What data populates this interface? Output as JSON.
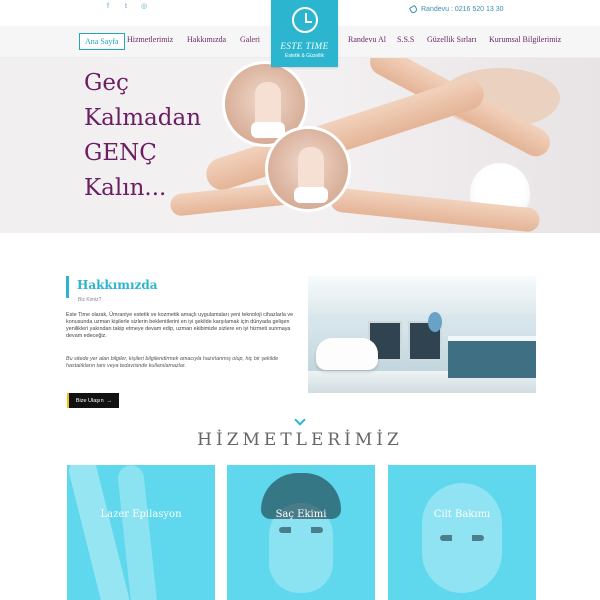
{
  "topbar": {
    "social": [
      {
        "icon": "facebook-icon",
        "glyph": "f"
      },
      {
        "icon": "twitter-icon",
        "glyph": "t"
      },
      {
        "icon": "instagram-icon",
        "glyph": "◎"
      }
    ],
    "phone": "Randevu : 0216 520 13 30"
  },
  "logo": {
    "name": "ESTE TIME",
    "tagline": "Estetik & Güzellik"
  },
  "nav": {
    "items": [
      {
        "label": "Ana Sayfa",
        "active": true
      },
      {
        "label": "Hizmetlerimiz"
      },
      {
        "label": "Hakkımızda"
      },
      {
        "label": "Galeri"
      },
      {
        "label": "Randevu Al"
      },
      {
        "label": "S.S.S"
      },
      {
        "label": "Güzellik Sırları"
      },
      {
        "label": "Kurumsal Bilgilerimiz"
      }
    ]
  },
  "hero": {
    "lines": [
      "Geç",
      "Kalmadan",
      "GENÇ",
      "Kalın..."
    ]
  },
  "about": {
    "title": "Hakkımızda",
    "subtitle": "Biz Kimiz?",
    "p1": "Este Time olarak, Ümraniye estetik ve kozmetik amaçlı uygulamaları yeni teknoloji cihazlarla ve konusunda uzman kişilerle sizlerin beklentilerini en iyi şekilde karşılamak için dünyada gelişen yenilikleri yakından takip etmeye devam edip, uzman ekibimizle sizlere en iyi hizmeti sunmaya devam edeceğiz.",
    "p2": "Bu sitede yer alan bilgiler, kişileri bilgilendirmek amacıyla hazırlanmış olup, hiç bir şekilde hastalıkların tanı veya tedavisinde kullanılamazlar.",
    "button": "Bize Ulaşın"
  },
  "services": {
    "title": "HİZMETLERİMİZ",
    "cards": [
      {
        "label": "Lazer Epilasyon"
      },
      {
        "label": "Saç Ekimi"
      },
      {
        "label": "Cilt Bakımı"
      }
    ]
  },
  "colors": {
    "accent": "#2bb5cf",
    "brand_purple": "#6b1f63",
    "card_overlay": "#5fd7ec"
  }
}
